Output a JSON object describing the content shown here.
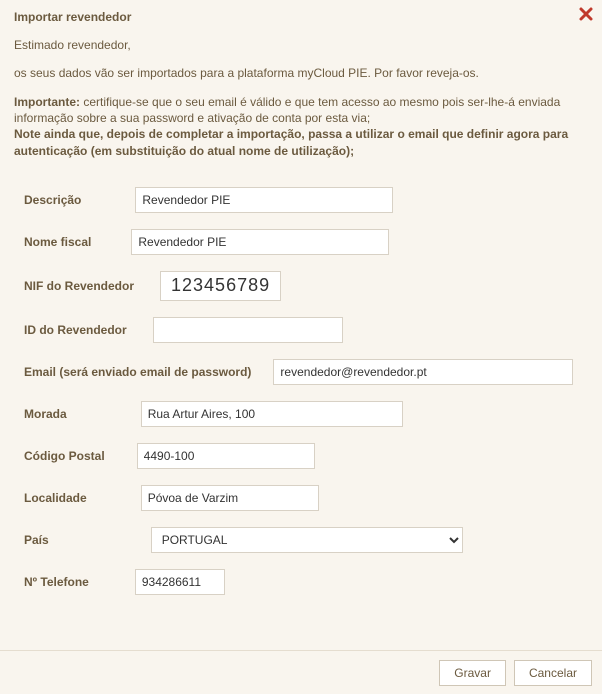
{
  "title": "Importar revendedor",
  "greeting": "Estimado revendedor,",
  "intro": "os seus dados vão ser importados para a plataforma myCloud PIE. Por favor reveja-os.",
  "important_label": "Importante:",
  "important_line1": " certifique-se que o seu email é válido e que tem acesso ao mesmo pois ser-lhe-á enviada informação sobre a sua password e ativação de conta por esta via;",
  "important_bold": "Note ainda que, depois de completar a importação, passa a utilizar o email que definir agora para autenticação (em substituição do atual nome de utilização);",
  "fields": {
    "descricao": {
      "label": "Descrição",
      "value": "Revendedor PIE"
    },
    "nome_fiscal": {
      "label": "Nome fiscal",
      "value": "Revendedor PIE"
    },
    "nif": {
      "label": "NIF do Revendedor",
      "value": "123456789"
    },
    "id_revendedor": {
      "label": "ID do Revendedor",
      "value": ""
    },
    "email": {
      "label": "Email (será enviado email de password)",
      "value": "revendedor@revendedor.pt"
    },
    "morada": {
      "label": "Morada",
      "value": "Rua Artur Aires, 100"
    },
    "cp": {
      "label": "Código Postal",
      "value": "4490-100"
    },
    "localidade": {
      "label": "Localidade",
      "value": "Póvoa de Varzim"
    },
    "pais": {
      "label": "País",
      "value": "PORTUGAL"
    },
    "telefone": {
      "label": "Nº Telefone",
      "value": "934286611"
    }
  },
  "buttons": {
    "save": "Gravar",
    "cancel": "Cancelar"
  }
}
